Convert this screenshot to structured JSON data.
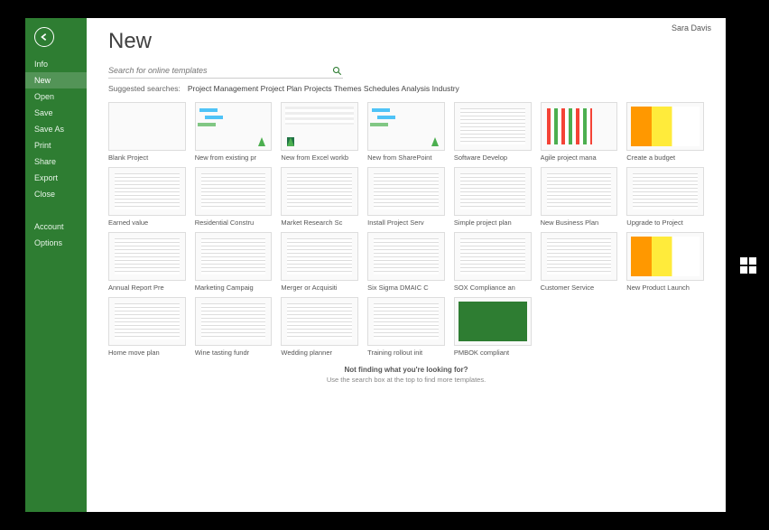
{
  "user": "Sara Davis",
  "title": "New",
  "search_placeholder": "Search for online templates",
  "sugg_label": "Suggested searches:",
  "sugg": [
    "Project Management",
    "Project Plan",
    "Projects",
    "Themes",
    "Schedules",
    "Analysis",
    "Industry"
  ],
  "nav1": [
    "Info",
    "New",
    "Open",
    "Save",
    "Save As",
    "Print",
    "Share",
    "Export",
    "Close"
  ],
  "nav2": [
    "Account",
    "Options"
  ],
  "nav_selected": "New",
  "templates": [
    {
      "label": "Blank Project",
      "th": ""
    },
    {
      "label": "New from existing pr",
      "th": "th-gantt th-arrow"
    },
    {
      "label": "New from Excel workb",
      "th": "th-excel th-arrow"
    },
    {
      "label": "New from SharePoint",
      "th": "th-gantt th-arrow"
    },
    {
      "label": "Software Develop",
      "th": "th-doc"
    },
    {
      "label": "Agile project mana",
      "th": "th-bars"
    },
    {
      "label": "Create a budget",
      "th": "th-color"
    },
    {
      "label": "Earned value",
      "th": "th-doc"
    },
    {
      "label": "Residential Constru",
      "th": "th-doc"
    },
    {
      "label": "Market Research Sc",
      "th": "th-doc"
    },
    {
      "label": "Install Project Serv",
      "th": "th-doc"
    },
    {
      "label": "Simple project plan",
      "th": "th-doc"
    },
    {
      "label": "New Business Plan",
      "th": "th-doc"
    },
    {
      "label": "Upgrade to Project",
      "th": "th-doc"
    },
    {
      "label": "Annual Report Pre",
      "th": "th-doc"
    },
    {
      "label": "Marketing Campaig",
      "th": "th-doc"
    },
    {
      "label": "Merger or Acquisiti",
      "th": "th-doc"
    },
    {
      "label": "Six Sigma DMAIC C",
      "th": "th-doc"
    },
    {
      "label": "SOX Compliance an",
      "th": "th-doc"
    },
    {
      "label": "Customer Service",
      "th": "th-doc"
    },
    {
      "label": "New Product Launch",
      "th": "th-color"
    },
    {
      "label": "Home move plan",
      "th": "th-doc"
    },
    {
      "label": "Wine tasting fundr",
      "th": "th-doc"
    },
    {
      "label": "Wedding planner",
      "th": "th-doc"
    },
    {
      "label": "Training rollout init",
      "th": "th-doc"
    },
    {
      "label": "PMBOK compliant",
      "th": "th-green"
    }
  ],
  "footer1": "Not finding what you're looking for?",
  "footer2": "Use the search box at the top to find more templates."
}
